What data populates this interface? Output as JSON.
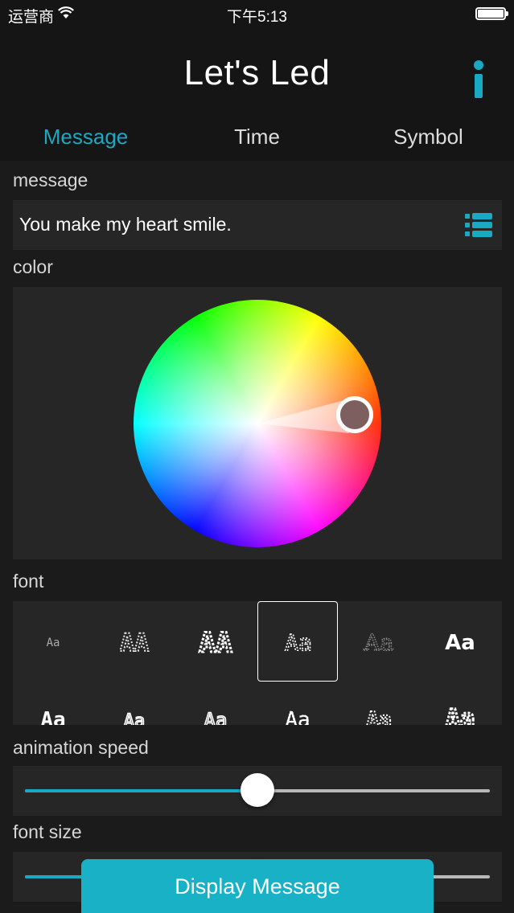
{
  "status_bar": {
    "carrier": "运营商",
    "time": "下午5:13"
  },
  "header": {
    "title": "Let's Led"
  },
  "tabs": [
    {
      "label": "Message",
      "active": true
    },
    {
      "label": "Time",
      "active": false
    },
    {
      "label": "Symbol",
      "active": false
    }
  ],
  "message": {
    "label": "message",
    "value": "You make my heart smile."
  },
  "color": {
    "label": "color",
    "selected_color": "#7d5f5f"
  },
  "font": {
    "label": "font",
    "selected_index": 3,
    "samples": [
      "Aa",
      "AA",
      "AA",
      "Aa",
      "Aa",
      "Aa",
      "Aa",
      "Aa",
      "Aa",
      "Aa",
      "Aa",
      "Aa"
    ]
  },
  "animation_speed": {
    "label": "animation speed",
    "value": 0.5
  },
  "font_size": {
    "label": "font size",
    "value": 0.5
  },
  "display_button": {
    "label": "Display Message"
  },
  "colors": {
    "accent": "#19a9c3",
    "button": "#18b1c6",
    "background": "#1b1b1b",
    "panel": "#262626"
  }
}
